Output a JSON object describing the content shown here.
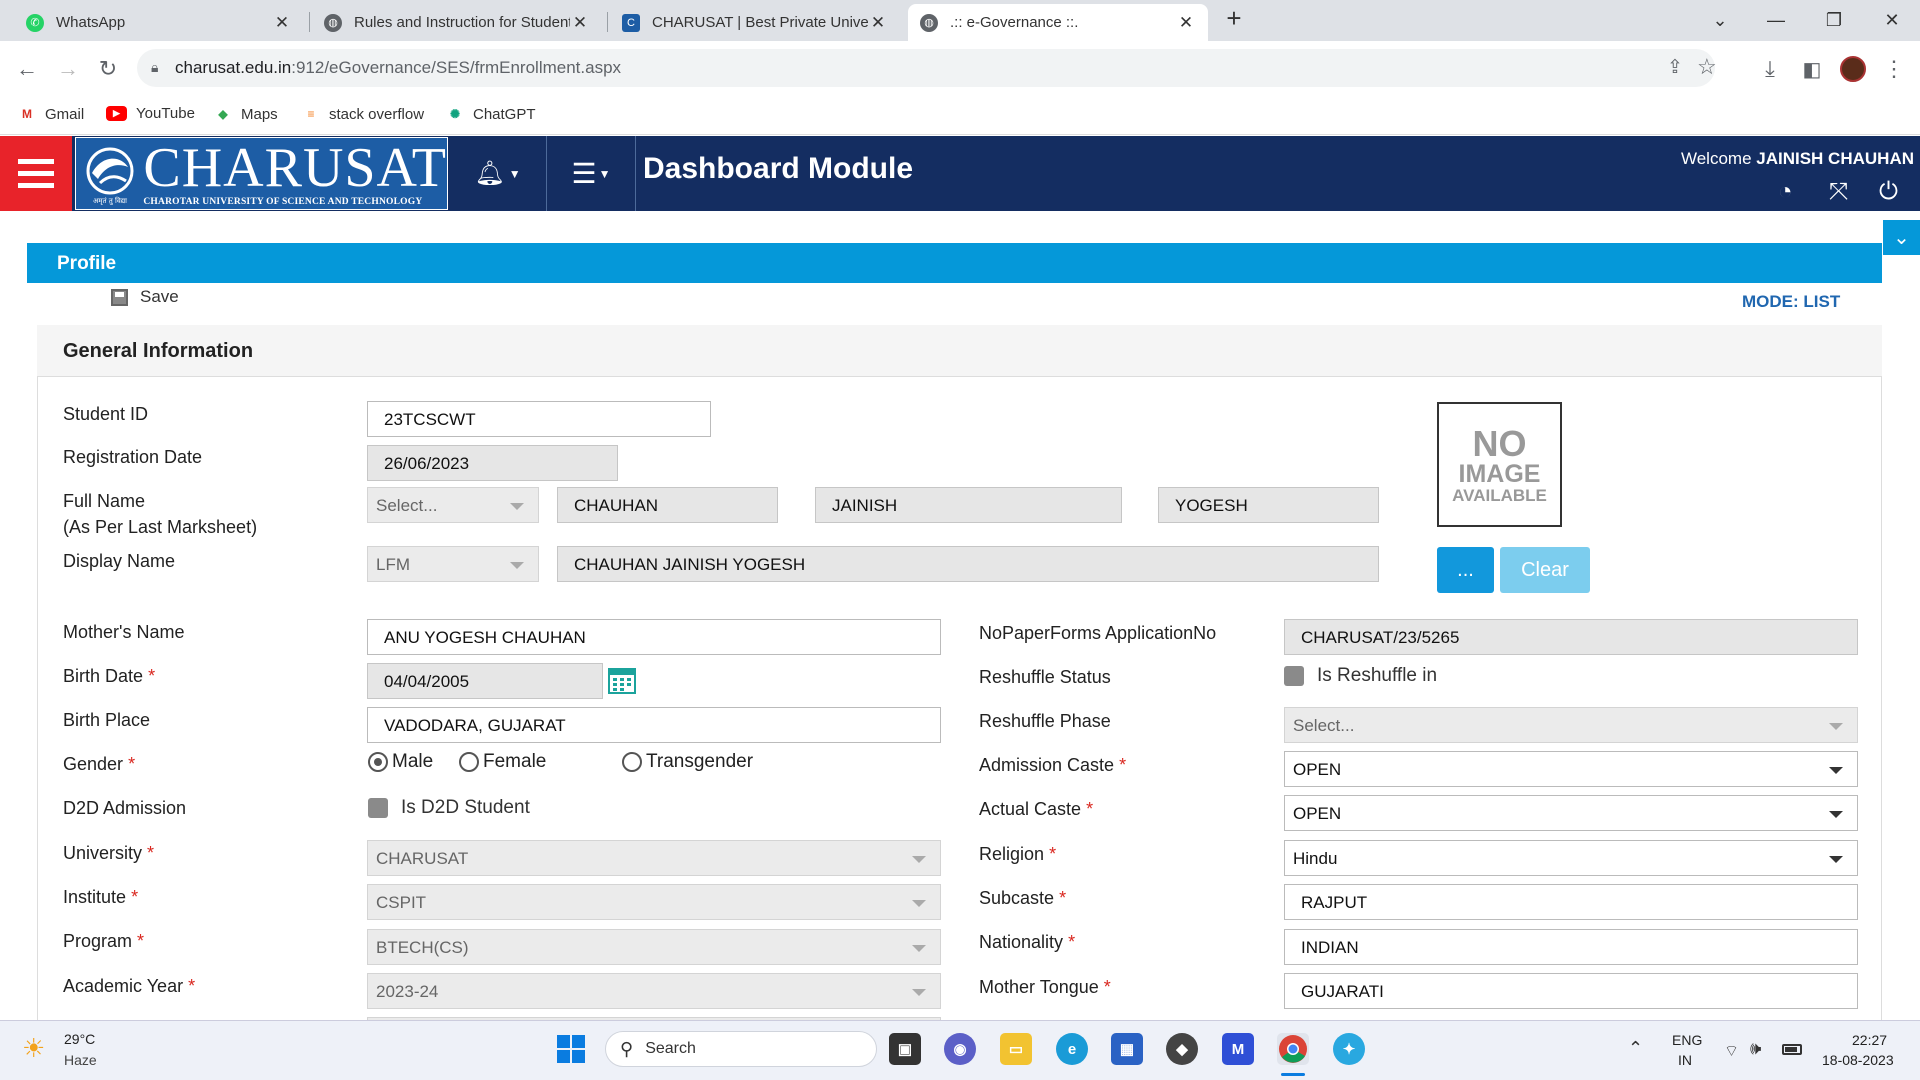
{
  "browser": {
    "tabs": [
      {
        "title": "WhatsApp"
      },
      {
        "title": "Rules and Instruction for Student"
      },
      {
        "title": "CHARUSAT | Best Private Universi"
      },
      {
        "title": ".:: e-Governance ::."
      }
    ],
    "new_tab": "+",
    "url_host": "charusat.edu.in",
    "url_path": ":912/eGovernance/SES/frmEnrollment.aspx",
    "bookmarks": [
      {
        "label": "Gmail"
      },
      {
        "label": "YouTube"
      },
      {
        "label": "Maps"
      },
      {
        "label": "stack overflow"
      },
      {
        "label": "ChatGPT"
      }
    ]
  },
  "header": {
    "logo_name": "CHARUSAT",
    "logo_sub": "CHAROTAR UNIVERSITY OF SCIENCE AND TECHNOLOGY",
    "title": "Dashboard Module",
    "welcome_prefix": "Welcome",
    "user": "JAINISH CHAUHAN",
    "colors": {
      "navy": "#142d61",
      "red": "#e8232a",
      "blue": "#0598d9"
    }
  },
  "profile": {
    "bar_title": "Profile",
    "save": "Save",
    "mode": "MODE: LIST",
    "section_title": "General Information"
  },
  "form": {
    "student_id_label": "Student ID",
    "student_id": "23TCSCWT",
    "reg_date_label": "Registration Date",
    "reg_date": "26/06/2023",
    "full_name_label": "Full Name",
    "full_name_sub": "(As Per Last Marksheet)",
    "title_select": "Select...",
    "last_name": "CHAUHAN",
    "first_name": "JAINISH",
    "middle_name": "YOGESH",
    "display_name_label": "Display Name",
    "display_format": "LFM",
    "display_name": "CHAUHAN JAINISH YOGESH",
    "photo_line1": "NO",
    "photo_line2": "IMAGE",
    "photo_line3": "AVAILABLE",
    "browse_label": "...",
    "clear_label": "Clear",
    "mother_label": "Mother's Name",
    "mother": "ANU YOGESH CHAUHAN",
    "birth_date_label": "Birth Date",
    "birth_date": "04/04/2005",
    "birth_place_label": "Birth Place",
    "birth_place": "VADODARA, GUJARAT",
    "gender_label": "Gender",
    "gender_options": [
      "Male",
      "Female",
      "Transgender"
    ],
    "gender_selected": "Male",
    "d2d_label": "D2D Admission",
    "d2d_check": "Is D2D Student",
    "university_label": "University",
    "university": "CHARUSAT",
    "institute_label": "Institute",
    "institute": "CSPIT",
    "program_label": "Program",
    "program": "BTECH(CS)",
    "academic_year_label": "Academic Year",
    "academic_year": "2023-24",
    "nopaper_label": "NoPaperForms ApplicationNo",
    "nopaper": "CHARUSAT/23/5265",
    "reshuffle_status_label": "Reshuffle Status",
    "reshuffle_check": "Is Reshuffle in",
    "reshuffle_phase_label": "Reshuffle Phase",
    "reshuffle_phase": "Select...",
    "admission_caste_label": "Admission Caste",
    "admission_caste": "OPEN",
    "actual_caste_label": "Actual Caste",
    "actual_caste": "OPEN",
    "religion_label": "Religion",
    "religion": "Hindu",
    "subcaste_label": "Subcaste",
    "subcaste": "RAJPUT",
    "nationality_label": "Nationality",
    "nationality": "INDIAN",
    "mother_tongue_label": "Mother Tongue",
    "mother_tongue": "GUJARATI",
    "required_mark": "*"
  },
  "taskbar": {
    "temp": "29°C",
    "weather": "Haze",
    "search": "Search",
    "lang1": "ENG",
    "lang2": "IN",
    "time": "22:27",
    "date": "18-08-2023"
  }
}
